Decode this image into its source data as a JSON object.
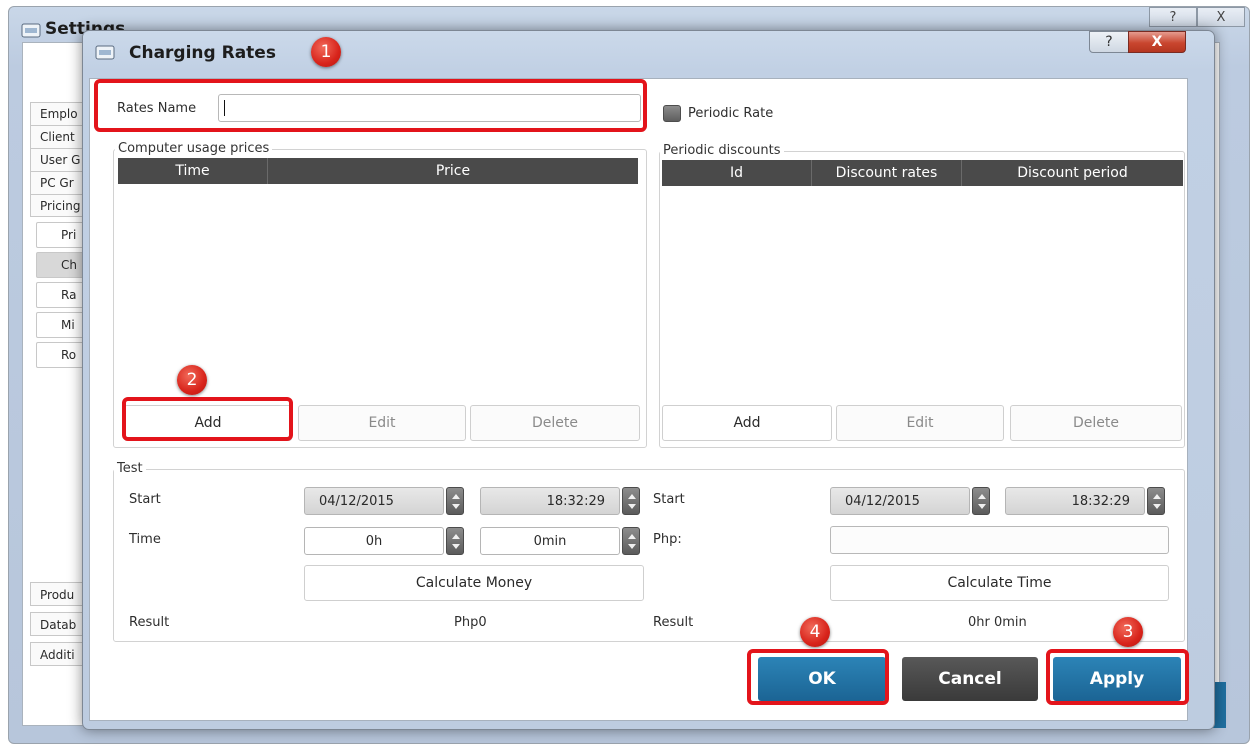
{
  "background_window": {
    "title": "Settings",
    "help_label": "?",
    "close_label": "X",
    "sidebar_items": [
      "Emplo",
      "Client",
      "User G",
      "PC Gr",
      "Pricing"
    ],
    "sidebar_subitems": [
      "Pri",
      "Ch",
      "Ra",
      "Mi",
      "Ro"
    ],
    "sidebar_bottom_items": [
      "Produ",
      "Datab",
      "Additi"
    ]
  },
  "dialog": {
    "title": "Charging Rates",
    "help_label": "?",
    "close_label": "X",
    "rates_name_label": "Rates Name",
    "rates_name_value": "",
    "periodic_rate_label": "Periodic Rate",
    "usage_prices": {
      "title": "Computer usage prices",
      "columns": [
        "Time",
        "Price"
      ],
      "add": "Add",
      "edit": "Edit",
      "delete": "Delete"
    },
    "periodic_discounts": {
      "title": "Periodic discounts",
      "columns": [
        "Id",
        "Discount rates",
        "Discount period"
      ],
      "add": "Add",
      "edit": "Edit",
      "delete": "Delete"
    },
    "test": {
      "title": "Test",
      "left": {
        "start_label": "Start",
        "start_date": "04/12/2015",
        "start_time": "18:32:29",
        "time_label": "Time",
        "hours": "0h",
        "minutes": "0min",
        "calc_button": "Calculate Money",
        "result_label": "Result",
        "result_value": "Php0"
      },
      "right": {
        "start_label": "Start",
        "start_date": "04/12/2015",
        "start_time": "18:32:29",
        "php_label": "Php:",
        "php_value": "",
        "calc_button": "Calculate Time",
        "result_label": "Result",
        "result_value": "0hr 0min"
      }
    },
    "buttons": {
      "ok": "OK",
      "cancel": "Cancel",
      "apply": "Apply"
    }
  },
  "annotations": {
    "badge_1": "1",
    "badge_2": "2",
    "badge_3": "3",
    "badge_4": "4",
    "highlight_color": "#e3141b"
  }
}
